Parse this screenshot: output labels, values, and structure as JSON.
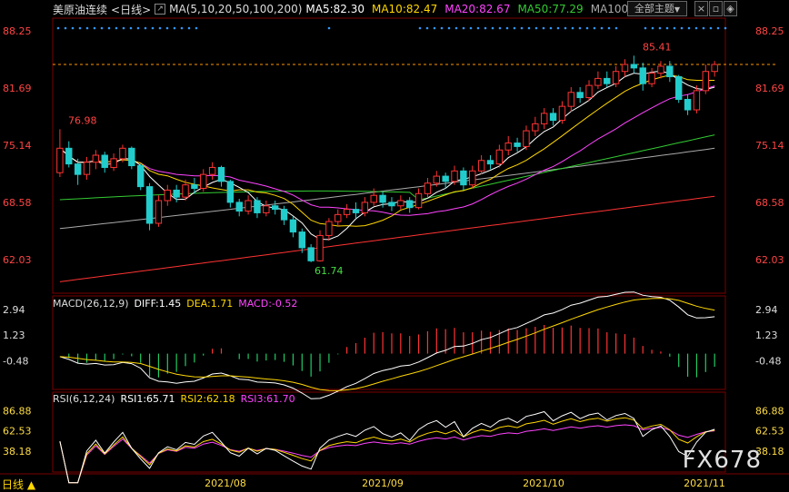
{
  "header": {
    "symbol": "美原油连续",
    "period": "<日线>",
    "ma_label": "MA(5,10,20,50,100,200)",
    "ma5": "MA5:82.30",
    "ma10": "MA10:82.47",
    "ma20": "MA20:82.67",
    "ma50": "MA50:77.29",
    "ma100": "MA100",
    "dropdown": "全部主题",
    "colors": {
      "ma5": "#ffffff",
      "ma10": "#ffd700",
      "ma20": "#ff44ff",
      "ma50": "#33cc33",
      "ma100": "#aaaaaa",
      "ma200": "#ff3333",
      "up": "#ff3333",
      "down": "#22cccc"
    }
  },
  "price_axis": [
    "88.25",
    "81.69",
    "75.14",
    "68.58",
    "62.03"
  ],
  "macd_header": {
    "title": "MACD(26,12,9)",
    "diff": "DIFF:1.45",
    "dea": "DEA:1.71",
    "macd": "MACD:-0.52"
  },
  "macd_axis": [
    "2.94",
    "1.23",
    "-0.48"
  ],
  "rsi_header": {
    "title": "RSI(6,12,24)",
    "rsi1": "RSI1:65.71",
    "rsi2": "RSI2:62.18",
    "rsi3": "RSI3:61.70"
  },
  "rsi_axis": [
    "86.88",
    "62.53",
    "38.18"
  ],
  "x_axis": [
    "2021/08",
    "2021/09",
    "2021/10",
    "2021/11"
  ],
  "bottom_label": "日线 ▲",
  "watermark": "FX678",
  "annotations": {
    "high": "76.98",
    "low": "61.74",
    "recent_high": "85.41"
  },
  "chart_data": {
    "type": "candlestick",
    "price_range": [
      58.5,
      89.5
    ],
    "last_price_line": 84.4,
    "candles": [
      [
        72.0,
        74.8,
        76.98,
        71.5
      ],
      [
        74.8,
        73.0,
        75.6,
        72.6
      ],
      [
        73.0,
        71.8,
        73.6,
        70.6
      ],
      [
        71.8,
        73.2,
        73.8,
        71.2
      ],
      [
        73.2,
        74.0,
        74.6,
        72.4
      ],
      [
        74.0,
        72.6,
        74.4,
        72.0
      ],
      [
        72.6,
        73.6,
        74.2,
        72.2
      ],
      [
        73.6,
        74.8,
        75.2,
        73.2
      ],
      [
        74.8,
        72.8,
        75.0,
        72.4
      ],
      [
        72.8,
        70.4,
        73.0,
        70.0
      ],
      [
        70.4,
        66.2,
        70.8,
        65.4
      ],
      [
        66.2,
        68.8,
        69.4,
        65.8
      ],
      [
        68.8,
        70.0,
        70.6,
        68.2
      ],
      [
        70.0,
        69.2,
        70.6,
        68.6
      ],
      [
        69.2,
        70.6,
        71.2,
        68.8
      ],
      [
        70.6,
        70.2,
        71.4,
        69.6
      ],
      [
        70.2,
        71.8,
        72.4,
        69.8
      ],
      [
        71.8,
        72.6,
        73.2,
        71.2
      ],
      [
        72.6,
        71.0,
        72.8,
        70.4
      ],
      [
        71.0,
        68.6,
        71.2,
        68.0
      ],
      [
        68.6,
        67.6,
        69.0,
        67.0
      ],
      [
        67.6,
        68.8,
        69.4,
        67.2
      ],
      [
        68.8,
        67.4,
        69.2,
        66.8
      ],
      [
        67.4,
        68.2,
        68.8,
        67.0
      ],
      [
        68.2,
        67.8,
        68.8,
        67.2
      ],
      [
        67.8,
        66.6,
        68.2,
        66.0
      ],
      [
        66.6,
        65.2,
        67.0,
        64.6
      ],
      [
        65.2,
        63.4,
        65.6,
        62.8
      ],
      [
        63.4,
        61.9,
        63.8,
        61.74
      ],
      [
        61.9,
        64.8,
        65.4,
        61.8
      ],
      [
        64.8,
        66.4,
        66.8,
        64.2
      ],
      [
        66.4,
        67.2,
        67.8,
        65.8
      ],
      [
        67.2,
        67.8,
        68.4,
        66.8
      ],
      [
        67.8,
        67.4,
        68.6,
        66.8
      ],
      [
        67.4,
        68.6,
        69.2,
        67.0
      ],
      [
        68.6,
        69.4,
        70.2,
        68.2
      ],
      [
        69.4,
        68.6,
        69.8,
        68.0
      ],
      [
        68.6,
        68.2,
        69.2,
        67.6
      ],
      [
        68.2,
        68.8,
        69.4,
        67.8
      ],
      [
        68.8,
        68.0,
        69.2,
        67.4
      ],
      [
        68.0,
        69.6,
        70.2,
        67.8
      ],
      [
        69.6,
        70.8,
        71.4,
        69.2
      ],
      [
        70.8,
        71.6,
        72.2,
        70.4
      ],
      [
        71.6,
        71.0,
        72.0,
        70.2
      ],
      [
        71.0,
        72.2,
        72.8,
        70.6
      ],
      [
        72.2,
        70.6,
        72.6,
        70.0
      ],
      [
        70.6,
        72.2,
        72.8,
        70.2
      ],
      [
        72.2,
        73.4,
        74.0,
        71.8
      ],
      [
        73.4,
        73.0,
        74.0,
        72.4
      ],
      [
        73.0,
        74.6,
        75.2,
        72.6
      ],
      [
        74.6,
        75.4,
        76.2,
        74.0
      ],
      [
        75.4,
        75.0,
        76.0,
        74.4
      ],
      [
        75.0,
        76.8,
        77.4,
        74.6
      ],
      [
        76.8,
        77.6,
        78.4,
        76.2
      ],
      [
        77.6,
        78.8,
        79.4,
        77.0
      ],
      [
        78.8,
        78.0,
        79.4,
        77.4
      ],
      [
        78.0,
        79.6,
        80.2,
        77.6
      ],
      [
        79.6,
        81.2,
        81.8,
        79.0
      ],
      [
        81.2,
        80.6,
        81.8,
        80.0
      ],
      [
        80.6,
        82.0,
        82.6,
        80.2
      ],
      [
        82.0,
        82.8,
        83.6,
        81.6
      ],
      [
        82.8,
        82.2,
        83.6,
        81.8
      ],
      [
        82.2,
        83.6,
        84.2,
        81.8
      ],
      [
        83.6,
        84.4,
        85.0,
        83.0
      ],
      [
        84.4,
        84.0,
        85.41,
        83.4
      ],
      [
        84.0,
        82.2,
        84.6,
        81.4
      ],
      [
        82.2,
        83.4,
        84.0,
        81.8
      ],
      [
        83.4,
        84.2,
        84.8,
        82.8
      ],
      [
        84.2,
        83.0,
        84.8,
        82.4
      ],
      [
        83.0,
        80.4,
        83.2,
        80.0
      ],
      [
        80.4,
        79.2,
        81.0,
        78.6
      ],
      [
        79.2,
        81.4,
        82.0,
        78.8
      ],
      [
        81.4,
        83.6,
        84.4,
        81.0
      ],
      [
        83.6,
        84.4,
        84.8,
        83.0
      ]
    ],
    "macd_range": [
      -2.2,
      3.6
    ],
    "rsi_range": [
      15,
      95
    ],
    "up_color": "#ff3333",
    "down_color": "#22cccc",
    "ma_colors": [
      "#ffffff",
      "#ffd700",
      "#ff44ff",
      "#33cc33",
      "#aaaaaa",
      "#ff3333"
    ]
  }
}
